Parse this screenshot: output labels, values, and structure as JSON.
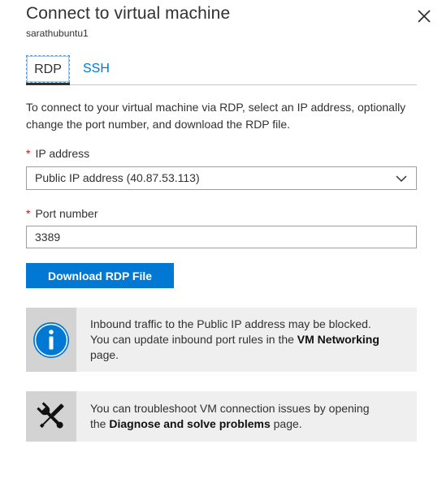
{
  "header": {
    "title": "Connect to virtual machine",
    "subtitle": "sarathubuntu1"
  },
  "tabs": [
    {
      "label": "RDP",
      "active": true
    },
    {
      "label": "SSH",
      "active": false
    }
  ],
  "description": "To connect to your virtual machine via RDP, select an IP address, optionally change the port number, and download the RDP file.",
  "ip_field": {
    "required_mark": "*",
    "label": "IP address",
    "selected_value": "Public IP address (40.87.53.113)"
  },
  "port_field": {
    "required_mark": "*",
    "label": "Port number",
    "value": "3389"
  },
  "download_button": {
    "label": "Download RDP File"
  },
  "info_boxes": [
    {
      "icon": "info-icon",
      "line1": "Inbound traffic to the Public IP address may be blocked.",
      "line2_prefix": "You can update inbound port rules in the ",
      "link": "VM Networking",
      "line3": "page."
    },
    {
      "icon": "tools-icon",
      "line1": "You can troubleshoot VM connection issues by opening",
      "line2_prefix": "the ",
      "link": "Diagnose and solve problems",
      "line2_suffix": " page."
    }
  ],
  "colors": {
    "accent": "#0078d4",
    "required": "#c50f1f",
    "info_bg": "#efefef",
    "icon_bg": "#d3d3d3"
  }
}
